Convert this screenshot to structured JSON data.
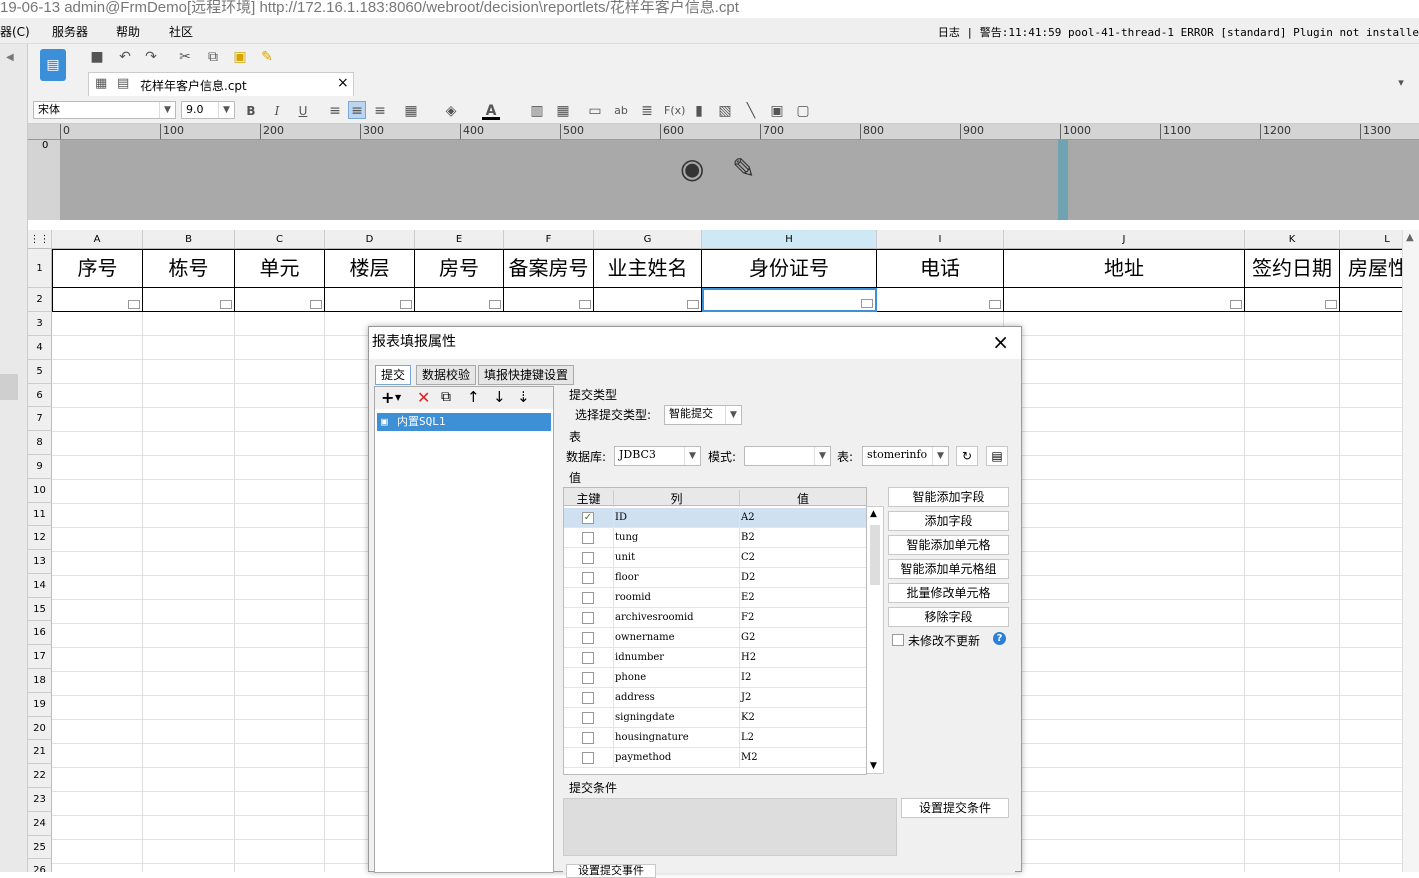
{
  "window": {
    "title": "19-06-13 admin@FrmDemo[远程环境]    http://172.16.1.183:8060/webroot/decision\\reportlets/花样年客户信息.cpt"
  },
  "menubar": {
    "items": [
      "器(C)",
      "服务器",
      "帮助",
      "社区"
    ],
    "log": "日志 | 警告:11:41:59 pool-41-thread-1 ERROR [standard] Plugin not installe"
  },
  "file_tab": {
    "name": "花样年客户信息.cpt"
  },
  "format_bar": {
    "font": "宋体",
    "size": "9.0"
  },
  "ruler": {
    "ticks": [
      "0",
      "100",
      "200",
      "300",
      "400",
      "500",
      "600",
      "700",
      "800",
      "900",
      "1000",
      "1100",
      "1200",
      "1300"
    ],
    "vertical_label": "0"
  },
  "grid": {
    "columns": [
      "A",
      "B",
      "C",
      "D",
      "E",
      "F",
      "G",
      "H",
      "I",
      "J",
      "K",
      "L"
    ],
    "header_cells": [
      "序号",
      "栋号",
      "单元",
      "楼层",
      "房号",
      "备案房号",
      "业主姓名",
      "身份证号",
      "电话",
      "地址",
      "签约日期",
      "房屋性"
    ],
    "rows": [
      "1",
      "2",
      "3",
      "4",
      "5",
      "6",
      "7",
      "8",
      "9",
      "10",
      "11",
      "12",
      "13",
      "14",
      "15",
      "16",
      "17",
      "18",
      "19",
      "20",
      "21",
      "22",
      "23",
      "24",
      "25",
      "26"
    ]
  },
  "dialog": {
    "title": "报表填报属性",
    "tabs": [
      "提交",
      "数据校验",
      "填报快捷键设置"
    ],
    "tree_item": "内置SQL1",
    "submit_type_section": "提交类型",
    "submit_type_label": "选择提交类型:",
    "submit_type_value": "智能提交",
    "table_section": "表",
    "database_label": "数据库:",
    "database_value": "JDBC3",
    "mode_label": "模式:",
    "mode_value": "",
    "table_label": "表:",
    "table_value": "stomerinfo",
    "values_section": "值",
    "col_headers": [
      "主键",
      "列",
      "值"
    ],
    "field_rows": [
      {
        "key": true,
        "col": "ID",
        "val": "A2"
      },
      {
        "key": false,
        "col": "tung",
        "val": "B2"
      },
      {
        "key": false,
        "col": "unit",
        "val": "C2"
      },
      {
        "key": false,
        "col": "floor",
        "val": "D2"
      },
      {
        "key": false,
        "col": "roomid",
        "val": "E2"
      },
      {
        "key": false,
        "col": "archivesroomid",
        "val": "F2"
      },
      {
        "key": false,
        "col": "ownername",
        "val": "G2"
      },
      {
        "key": false,
        "col": "idnumber",
        "val": "H2"
      },
      {
        "key": false,
        "col": "phone",
        "val": "I2"
      },
      {
        "key": false,
        "col": "address",
        "val": "J2"
      },
      {
        "key": false,
        "col": "signingdate",
        "val": "K2"
      },
      {
        "key": false,
        "col": "housingnature",
        "val": "L2"
      },
      {
        "key": false,
        "col": "paymethod",
        "val": "M2"
      }
    ],
    "side_buttons": [
      "智能添加字段",
      "添加字段",
      "智能添加单元格",
      "智能添加单元格组",
      "批量修改单元格",
      "移除字段"
    ],
    "no_update_label": "未修改不更新",
    "condition_section": "提交条件",
    "set_condition_button": "设置提交条件",
    "bottom_button": "设置提交事件"
  },
  "colors": {
    "selected_row": "#cfe0f0",
    "tree_selected": "#3d8fd6",
    "accent_page_edge": "#6fa3b2"
  }
}
